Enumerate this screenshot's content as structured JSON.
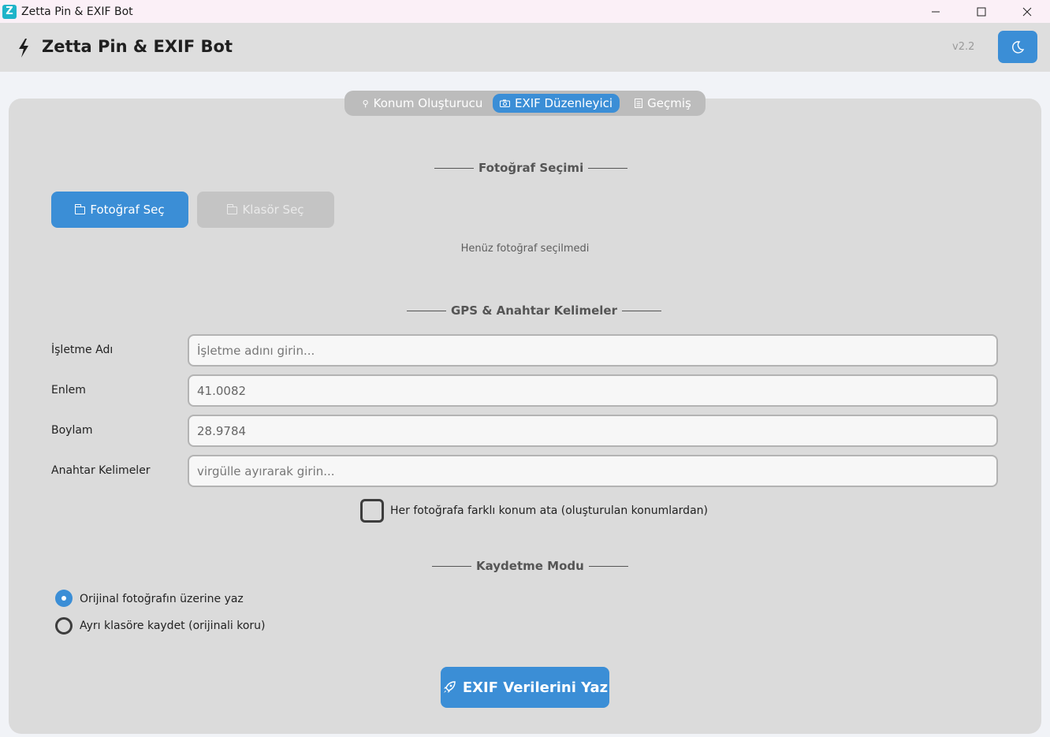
{
  "window": {
    "title": "Zetta Pin & EXIF Bot",
    "app_icon_letter": "Z",
    "controls": [
      "minimize-icon",
      "maximize-icon",
      "close-icon"
    ]
  },
  "header": {
    "icon": "bolt-icon",
    "title": "Zetta Pin & EXIF Bot",
    "version": "v2.2",
    "theme_toggle_icon": "moon-icon"
  },
  "tabs": [
    {
      "label": "Konum Oluşturucu",
      "icon": "pin-icon",
      "active": false
    },
    {
      "label": "EXIF Düzenleyici",
      "icon": "camera-icon",
      "active": true
    },
    {
      "label": "Geçmiş",
      "icon": "document-icon",
      "active": false
    }
  ],
  "photo_section": {
    "title": "Fotoğraf Seçimi",
    "select_photo_label": "Fotoğraf Seç",
    "select_folder_label": "Klasör Seç",
    "status": "Henüz fotoğraf seçilmedi"
  },
  "gps_section": {
    "title": "GPS & Anahtar Kelimeler",
    "fields": {
      "business": {
        "label": "İşletme Adı",
        "value": "",
        "placeholder": "İşletme adını girin..."
      },
      "latitude": {
        "label": "Enlem",
        "value": "41.0082",
        "placeholder": ""
      },
      "longitude": {
        "label": "Boylam",
        "value": "28.9784",
        "placeholder": ""
      },
      "keywords": {
        "label": "Anahtar Kelimeler",
        "value": "",
        "placeholder": "virgülle ayırarak girin..."
      }
    },
    "random_location_label": "Her fotoğrafa farklı konum ata (oluşturulan konumlardan)",
    "random_location_checked": false
  },
  "save_section": {
    "title": "Kaydetme Modu",
    "options": [
      {
        "label": "Orijinal fotoğrafın üzerine yaz",
        "selected": true
      },
      {
        "label": "Ayrı klasöre kaydet (orijinali koru)",
        "selected": false
      }
    ]
  },
  "write_button_label": "EXIF Verilerini Yaz",
  "colors": {
    "accent": "#3b8ed6",
    "panel": "#dbdbdb",
    "header": "#dedede",
    "disabled": "#c4c4c4"
  }
}
